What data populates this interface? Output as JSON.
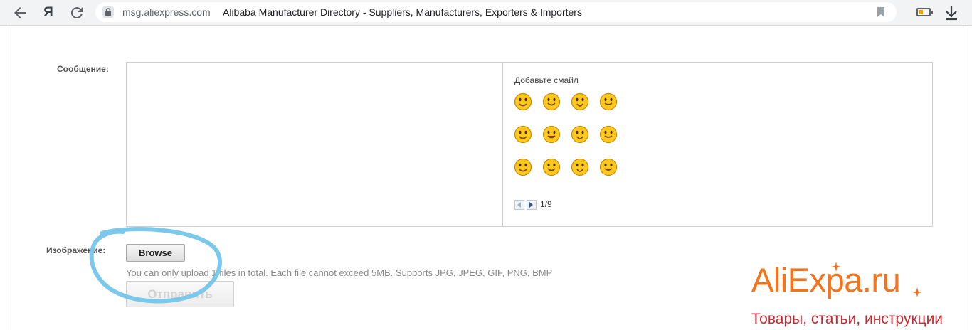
{
  "browser": {
    "url": "msg.aliexpress.com",
    "page_title": "Alibaba Manufacturer Directory - Suppliers, Manufacturers, Exporters & Importers",
    "yandex_label": "Я",
    "battery_level": 0.45
  },
  "form": {
    "message_label": "Сообщение:",
    "smiles_title": "Добавьте смайл",
    "smiles_page": "1/9",
    "image_label": "Изображение:",
    "browse_label": "Browse",
    "upload_hint": "You can only upload 1 files in total. Each file cannot exceed 5MB. Supports JPG, JPEG, GIF, PNG, BMP",
    "send_label": "Отправить"
  },
  "brand": {
    "logo_text": "AliExpa",
    "logo_suffix": ".ru",
    "subtitle": "Товары, статьи, инструкции",
    "colors": {
      "logo": "#f4731c",
      "subtitle": "#c9252c"
    }
  },
  "annotation": {
    "circle_color": "#7cc8ea"
  }
}
